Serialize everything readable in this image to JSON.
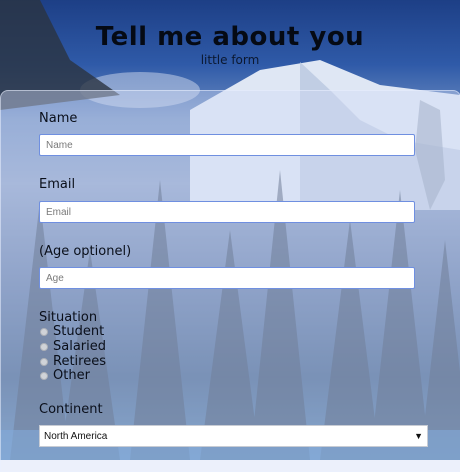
{
  "header": {
    "title": "Tell me about you",
    "subtitle": "little form"
  },
  "form": {
    "name": {
      "label": "Name",
      "placeholder": "Name",
      "value": ""
    },
    "email": {
      "label": "Email",
      "placeholder": "Email",
      "value": ""
    },
    "age": {
      "label": "(Age optionel)",
      "placeholder": "Age",
      "value": ""
    },
    "situation": {
      "label": "Situation",
      "options": [
        "Student",
        "Salaried",
        "Retirees",
        "Other"
      ]
    },
    "continent": {
      "label": "Continent",
      "selected": "North America",
      "caret": "▼"
    }
  },
  "colors": {
    "field_border": "#6f8fe0",
    "card_overlay": "rgba(210,220,245,0.42)"
  }
}
